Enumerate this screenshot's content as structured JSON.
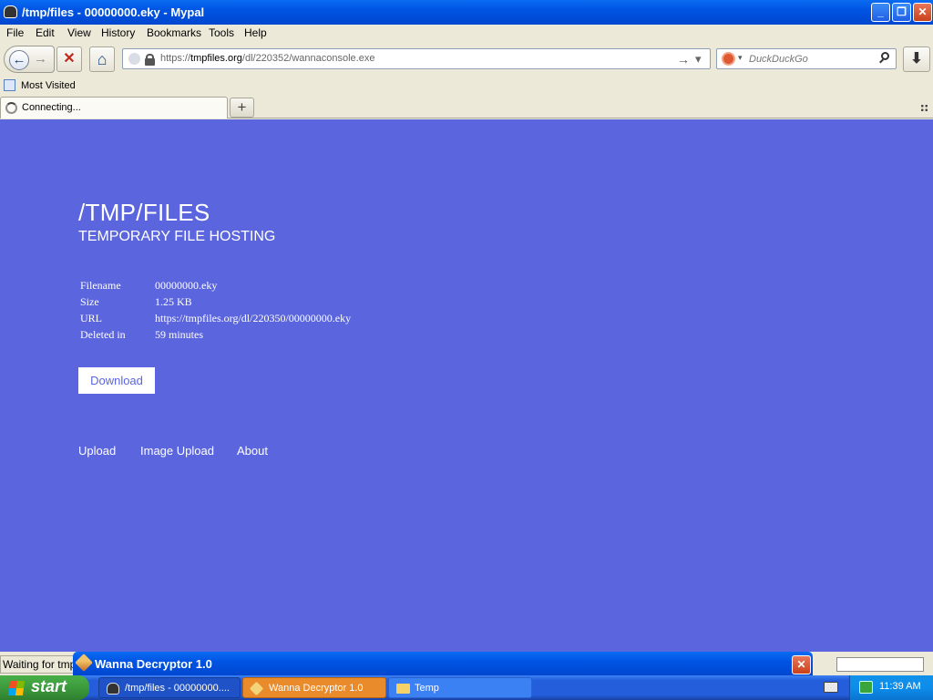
{
  "window": {
    "title": "/tmp/files - 00000000.eky - Mypal",
    "min_glyph": "_",
    "max_glyph": "❐",
    "close_glyph": "✕"
  },
  "menu": [
    "File",
    "Edit",
    "View",
    "History",
    "Bookmarks",
    "Tools",
    "Help"
  ],
  "toolbar": {
    "back_glyph": "←",
    "forward_glyph": "→",
    "stop_glyph": "✕",
    "home_glyph": "⌂",
    "go_glyph": "→",
    "dropdown_glyph": "▾",
    "download_glyph": "⬇"
  },
  "address": {
    "prefix": "https://",
    "host": "tmpfiles.org",
    "path": "/dl/220352/wannaconsole.exe"
  },
  "search": {
    "placeholder": "DuckDuckGo"
  },
  "bookmarks": {
    "most_visited": "Most Visited"
  },
  "tab": {
    "label": "Connecting...",
    "new_tab_glyph": "+"
  },
  "page": {
    "title": "/TMP/FILES",
    "subtitle": "TEMPORARY FILE HOSTING",
    "file_info": [
      {
        "label": "Filename",
        "value": "00000000.eky"
      },
      {
        "label": "Size",
        "value": "1.25 KB"
      },
      {
        "label": "URL",
        "value": "https://tmpfiles.org/dl/220350/00000000.eky"
      },
      {
        "label": "Deleted in",
        "value": "59 minutes"
      }
    ],
    "download_label": "Download",
    "footer_links": [
      "Upload",
      "Image Upload",
      "About"
    ]
  },
  "status": {
    "text": "Waiting for tmpfiles.org..."
  },
  "wanna": {
    "title": "Wanna Decryptor 1.0",
    "close_glyph": "✕"
  },
  "taskbar": {
    "start_label": "start",
    "tasks": [
      "/tmp/files - 00000000....",
      "Wanna Decryptor 1.0",
      "Temp"
    ],
    "clock": "11:39 AM"
  },
  "colors": {
    "page_bg": "#5b65de",
    "xp_blue": "#0054e3",
    "active_task": "#e98b2a"
  }
}
